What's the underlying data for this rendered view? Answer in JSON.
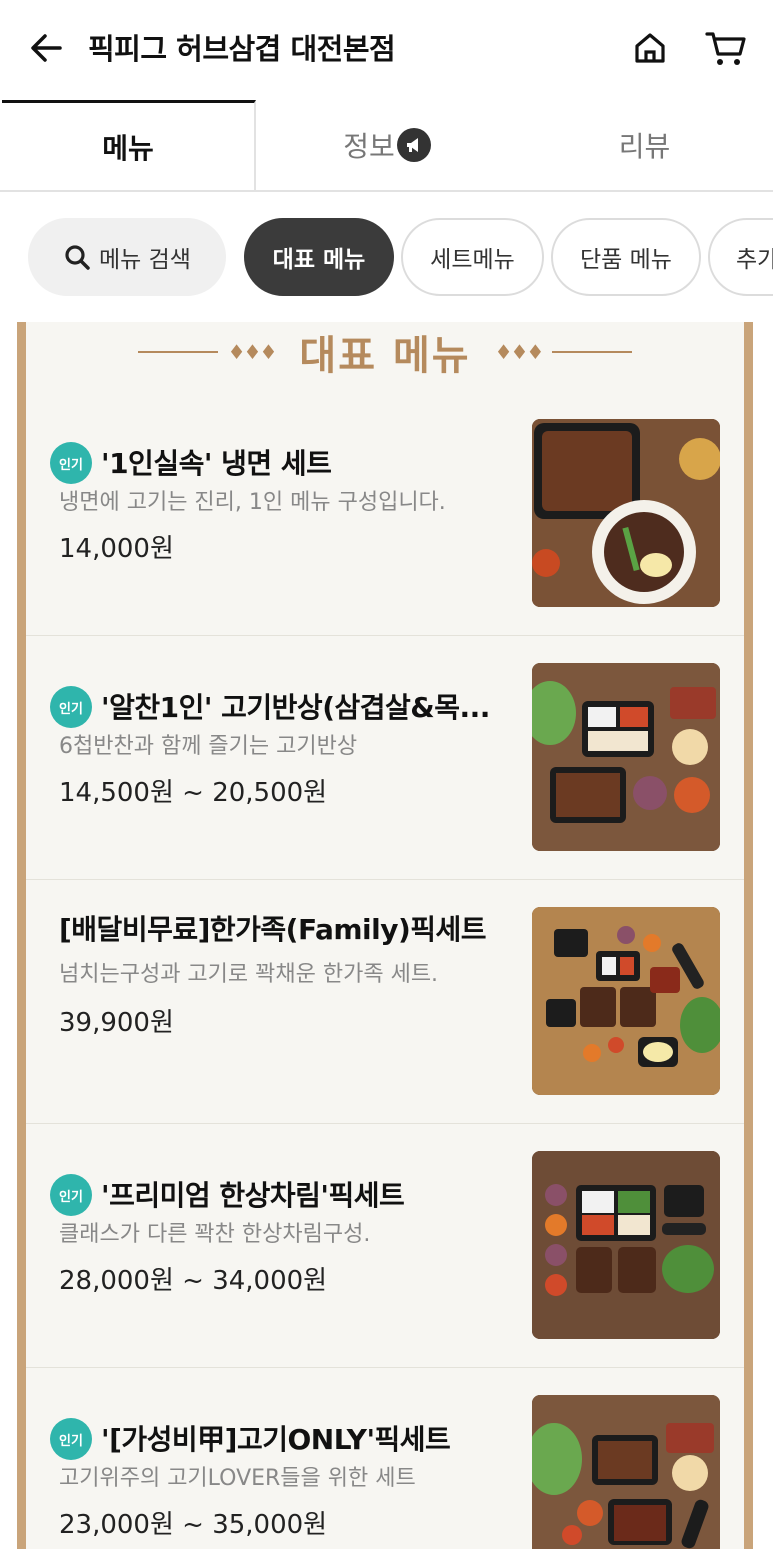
{
  "header": {
    "title": "픽피그 허브삼겹 대전본점",
    "back_icon": "arrow-left-icon",
    "home_icon": "home-icon",
    "cart_icon": "cart-icon"
  },
  "tabs": [
    {
      "label": "메뉴",
      "active": true
    },
    {
      "label": "정보",
      "icon": "megaphone-icon"
    },
    {
      "label": "리뷰"
    }
  ],
  "chips": {
    "search": "메뉴 검색",
    "items": [
      "대표 메뉴",
      "세트메뉴",
      "단품 메뉴",
      "추가"
    ]
  },
  "section": {
    "title": "대표 메뉴",
    "ornament_left": "♦♦♦",
    "ornament_right": "♦♦♦"
  },
  "colors": {
    "accent_gold": "#b58a5d",
    "panel_border": "#c9a47a",
    "badge_teal": "#2fb5ac",
    "active_chip": "#3b3b3b"
  },
  "menu_items": [
    {
      "badge": "인기",
      "name": "'1인실속' 냉면 세트",
      "desc": "냉면에 고기는 진리, 1인 메뉴 구성입니다.",
      "price": "14,000원"
    },
    {
      "badge": "인기",
      "name": "'알찬1인' 고기반상(삼겹살&목...",
      "desc": "6첩반찬과 함께 즐기는 고기반상",
      "price": "14,500원 ~ 20,500원"
    },
    {
      "badge": "",
      "name": "[배달비무료]한가족(Family)픽세트",
      "desc": "넘치는구성과 고기로 꽉채운 한가족 세트.",
      "price": "39,900원"
    },
    {
      "badge": "인기",
      "name": "'프리미엄 한상차림'픽세트",
      "desc": "클래스가 다른 꽉찬 한상차림구성.",
      "price": "28,000원 ~ 34,000원"
    },
    {
      "badge": "인기",
      "name": "'[가성비甲]고기ONLY'픽세트",
      "desc": "고기위주의 고기LOVER들을 위한 세트",
      "price": "23,000원 ~ 35,000원"
    }
  ]
}
